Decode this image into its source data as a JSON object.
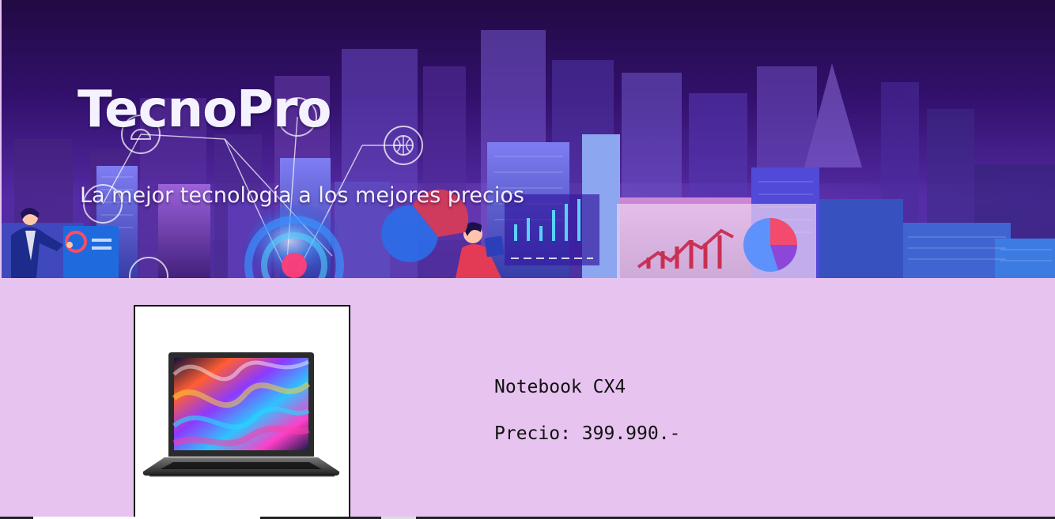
{
  "header": {
    "brand": "TecnoPro",
    "tagline": "La mejor tecnología a los mejores precios"
  },
  "product": {
    "name": "Notebook CX4",
    "price_label": "Precio",
    "price_value": "399.990.-",
    "price_text": "Precio: 399.990.-"
  },
  "colors": {
    "page_background": "#e7c3ef",
    "hero_dark_purple": "#250d4a",
    "hero_violet": "#4c1f92",
    "text_dark": "#111111",
    "text_light": "#f4f2ff",
    "accent_red": "#d53c59",
    "accent_blue": "#2a6ee8"
  },
  "icons": {
    "presentation": "presenter-illustration",
    "data_hub": "globe-icon",
    "analytics": "chart-icon",
    "laptop": "laptop-image"
  }
}
